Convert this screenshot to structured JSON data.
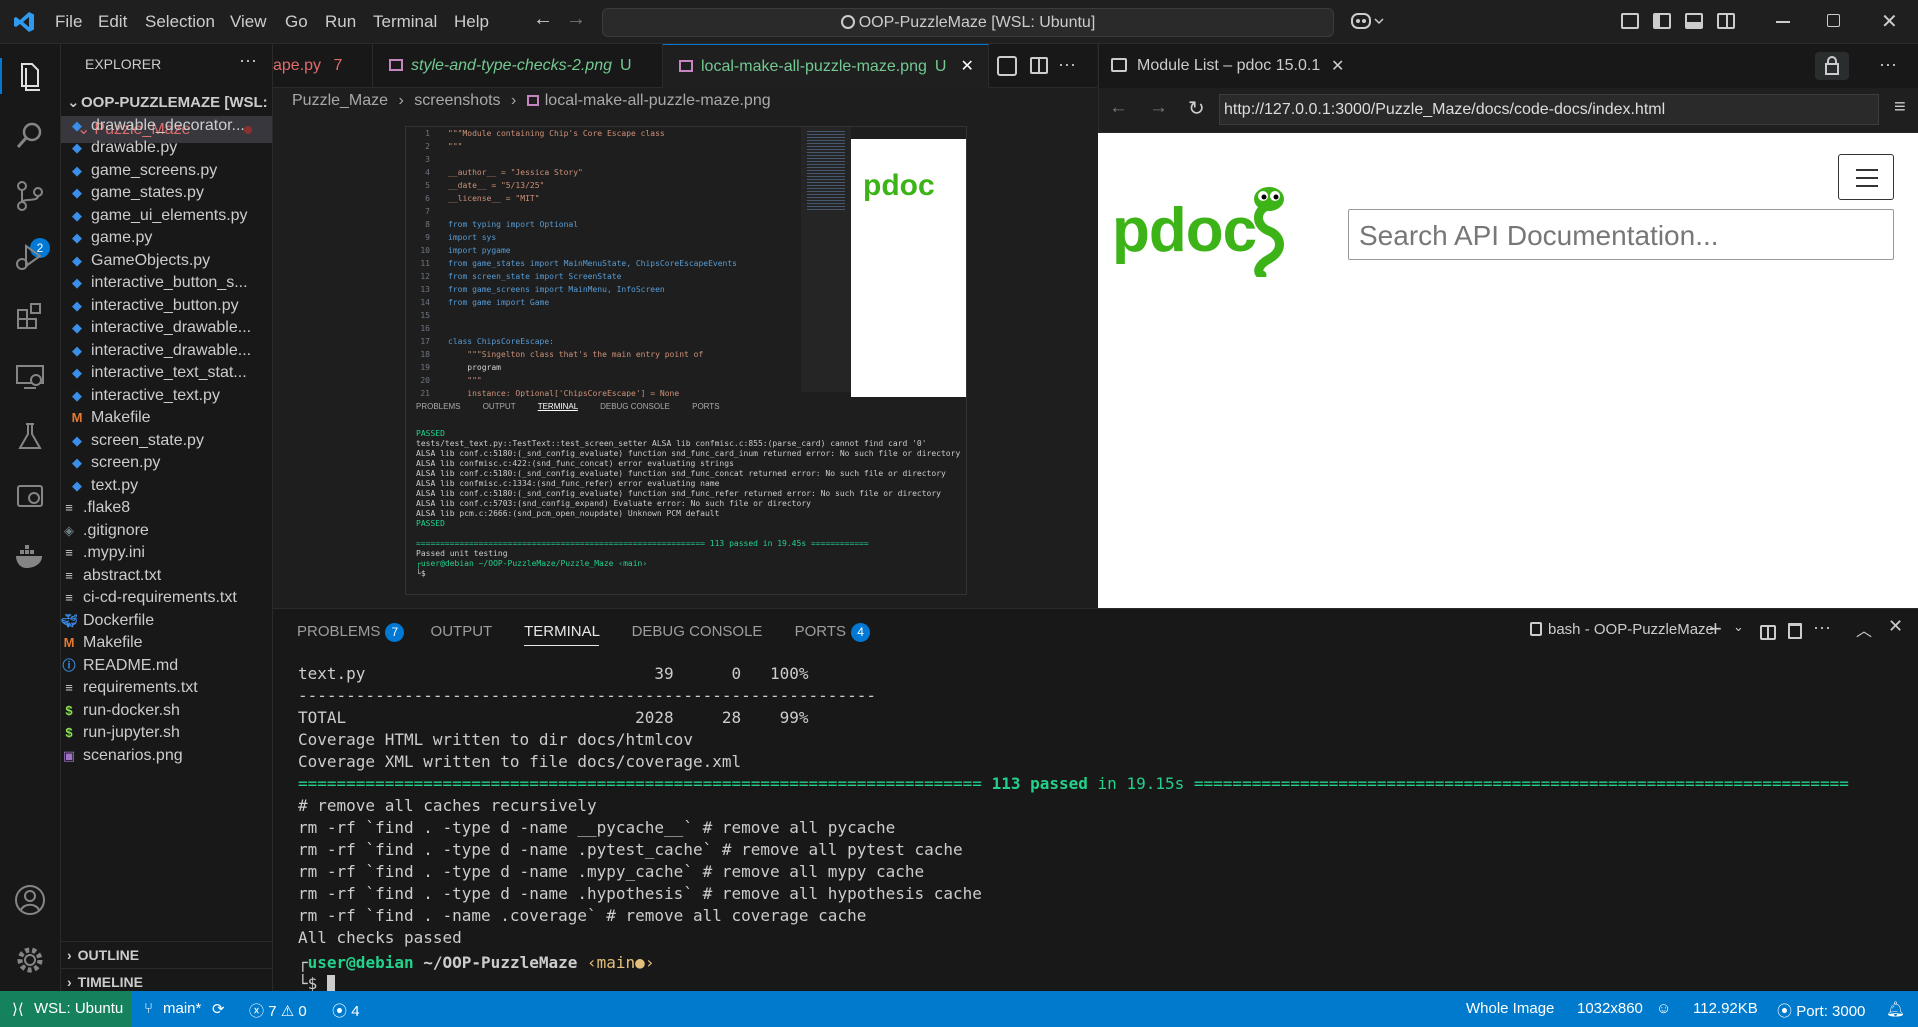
{
  "titlebar": {
    "menus": [
      "File",
      "Edit",
      "Selection",
      "View",
      "Go",
      "Run",
      "Terminal",
      "Help"
    ],
    "command_center": "OOP-PuzzleMaze [WSL: Ubuntu]"
  },
  "activity": {
    "source_control_badge": "2"
  },
  "explorer": {
    "title": "EXPLORER",
    "root": "OOP-PUZZLEMAZE [WSL: ...",
    "folder": "Puzzle_Maze",
    "items": [
      {
        "name": "drawable_decorator...",
        "icon": "py"
      },
      {
        "name": "drawable.py",
        "icon": "py"
      },
      {
        "name": "game_screens.py",
        "icon": "py"
      },
      {
        "name": "game_states.py",
        "icon": "py"
      },
      {
        "name": "game_ui_elements.py",
        "icon": "py"
      },
      {
        "name": "game.py",
        "icon": "py"
      },
      {
        "name": "GameObjects.py",
        "icon": "py"
      },
      {
        "name": "interactive_button_s...",
        "icon": "py"
      },
      {
        "name": "interactive_button.py",
        "icon": "py"
      },
      {
        "name": "interactive_drawable...",
        "icon": "py"
      },
      {
        "name": "interactive_drawable...",
        "icon": "py"
      },
      {
        "name": "interactive_text_stat...",
        "icon": "py"
      },
      {
        "name": "interactive_text.py",
        "icon": "py"
      },
      {
        "name": "Makefile",
        "icon": "make"
      },
      {
        "name": "screen_state.py",
        "icon": "py"
      },
      {
        "name": "screen.py",
        "icon": "py"
      },
      {
        "name": "text.py",
        "icon": "py"
      }
    ],
    "root_items": [
      {
        "name": ".flake8",
        "icon": "txt"
      },
      {
        "name": ".gitignore",
        "icon": "git"
      },
      {
        "name": ".mypy.ini",
        "icon": "txt"
      },
      {
        "name": "abstract.txt",
        "icon": "txt"
      },
      {
        "name": "ci-cd-requirements.txt",
        "icon": "txt"
      },
      {
        "name": "Dockerfile",
        "icon": "docker"
      },
      {
        "name": "Makefile",
        "icon": "make"
      },
      {
        "name": "README.md",
        "icon": "info"
      },
      {
        "name": "requirements.txt",
        "icon": "txt"
      },
      {
        "name": "run-docker.sh",
        "icon": "sh"
      },
      {
        "name": "run-jupyter.sh",
        "icon": "sh"
      },
      {
        "name": "scenarios.png",
        "icon": "img"
      }
    ],
    "outline": "OUTLINE",
    "timeline": "TIMELINE"
  },
  "editor": {
    "tabs": [
      {
        "label": "ape.py",
        "badge": "7",
        "color": "#e06c6c"
      },
      {
        "label": "style-and-type-checks-2.png",
        "badge": "U",
        "color": "#73c991"
      },
      {
        "label": "local-make-all-puzzle-maze.png",
        "badge": "U",
        "color": "#73c991"
      }
    ],
    "breadcrumb": [
      "Puzzle_Maze",
      "screenshots",
      "local-make-all-puzzle-maze.png"
    ]
  },
  "image_preview": {
    "code_lines": [
      "\"\"\"Module containing Chip's Core Escape class",
      "\"\"\"",
      "",
      "__author__ = \"Jessica Story\"",
      "__date__ = \"5/13/25\"",
      "__license__ = \"MIT\"",
      "",
      "from typing import Optional",
      "import sys",
      "import pygame",
      "from game_states import MainMenuState, ChipsCoreEscapeEvents",
      "from screen_state import ScreenState",
      "from game_screens import MainMenu, InfoScreen",
      "from game import Game",
      "",
      "",
      "class ChipsCoreEscape:",
      "    \"\"\"Singelton class that's the main entry point of",
      "    program",
      "    \"\"\"",
      "    instance: Optional['ChipsCoreEscape'] = None"
    ],
    "panel_tabs": [
      "PROBLEMS",
      "OUTPUT",
      "TERMINAL",
      "DEBUG CONSOLE",
      "PORTS"
    ],
    "terminal_lines": [
      "PASSED",
      "tests/test_text.py::TestText::test_screen_setter ALSA lib confmisc.c:855:(parse_card) cannot find card '0'",
      "ALSA lib conf.c:5180:(_snd_config_evaluate) function snd_func_card_inum returned error: No such file or directory",
      "ALSA lib confmisc.c:422:(snd_func_concat) error evaluating strings",
      "ALSA lib conf.c:5180:(_snd_config_evaluate) function snd_func_concat returned error: No such file or directory",
      "ALSA lib confmisc.c:1334:(snd_func_refer) error evaluating name",
      "ALSA lib conf.c:5180:(_snd_config_evaluate) function snd_func_refer returned error: No such file or directory",
      "ALSA lib conf.c:5703:(snd_config_expand) Evaluate error: No such file or directory",
      "ALSA lib pcm.c:2666:(snd_pcm_open_noupdate) Unknown PCM default",
      "PASSED",
      "",
      "============================================================ 113 passed in 19.45s ============",
      "Passed unit testing",
      "┌user@debian ~/OOP-PuzzleMaze/Puzzle_Maze ‹main›",
      "└$ "
    ]
  },
  "browser": {
    "tab_title": "Module List – pdoc 15.0.1",
    "url": "http://127.0.0.1:3000/Puzzle_Maze/docs/code-docs/index.html",
    "logo_text": "pdoc",
    "search_placeholder": "Search API Documentation..."
  },
  "panel": {
    "tabs": [
      {
        "label": "PROBLEMS",
        "badge": "7"
      },
      {
        "label": "OUTPUT"
      },
      {
        "label": "TERMINAL"
      },
      {
        "label": "DEBUG CONSOLE"
      },
      {
        "label": "PORTS",
        "badge": "4"
      }
    ],
    "terminal_name": "bash - OOP-PuzzleMaze",
    "lines": {
      "l1": "text.py                              39      0   100%",
      "l2": "------------------------------------------------------------",
      "l3": "TOTAL                              2028     28    99%",
      "l4": "Coverage HTML written to dir docs/htmlcov",
      "l5": "Coverage XML written to file docs/coverage.xml",
      "sep_left": "=======================================================================",
      "passed": "113 passed",
      "in_time": "in 19.15s",
      "sep_right": "====================================================================",
      "l7": "# remove all caches recursively",
      "l8": "rm -rf `find . -type d -name __pycache__` # remove all pycache",
      "l9": "rm -rf `find . -type d -name .pytest_cache` # remove all pytest cache",
      "l10": "rm -rf `find . -type d -name .mypy_cache` # remove all mypy cache",
      "l11": "rm -rf `find . -type d -name .hypothesis` # remove all hypothesis cache",
      "l12": "rm -rf `find . -name .coverage` # remove all coverage cache",
      "l13": "All checks passed",
      "prompt_user": "user@debian",
      "prompt_path": "~/OOP-PuzzleMaze",
      "prompt_branch": "‹main●›",
      "prompt_symbol": "$"
    }
  },
  "statusbar": {
    "remote": "WSL: Ubuntu",
    "branch": "main*",
    "errors": "7",
    "warnings": "0",
    "ports": "4",
    "view": "Whole Image",
    "dims": "1032x860",
    "size": "112.92KB",
    "port": "Port: 3000"
  },
  "colors": {
    "accent": "#007acc",
    "pdoc_green": "#3cb317",
    "passed_green": "#23d18b"
  }
}
